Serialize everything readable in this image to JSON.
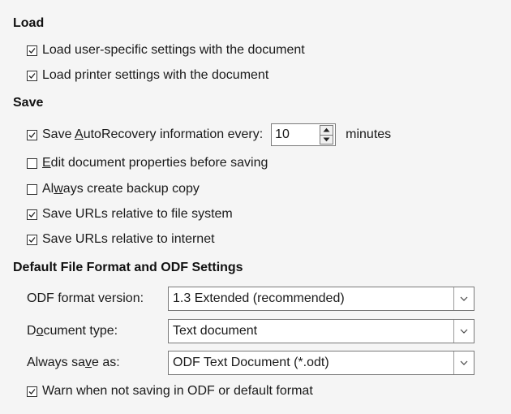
{
  "load": {
    "title": "Load",
    "options": [
      {
        "label": "Load user-specific settings with the document",
        "checked": true
      },
      {
        "label": "Load printer settings with the document",
        "checked": true
      }
    ]
  },
  "save": {
    "title": "Save",
    "autorecovery": {
      "label_pre": "Save ",
      "label_mnemonic": "A",
      "label_post": "utoRecovery information every:",
      "checked": true,
      "value": "10",
      "unit": "minutes"
    },
    "edit_props": {
      "label_mnemonic": "E",
      "label_post": "dit document properties before saving",
      "checked": false
    },
    "backup": {
      "label_pre": "Al",
      "label_mnemonic": "w",
      "label_post": "ays create backup copy",
      "checked": false
    },
    "urls_fs": {
      "label": "Save URLs relative to file system",
      "checked": true
    },
    "urls_inet": {
      "label": "Save URLs relative to internet",
      "checked": true
    }
  },
  "odf": {
    "title": "Default File Format and ODF Settings",
    "format_version": {
      "label": "ODF format version:",
      "value": "1.3 Extended (recommended)"
    },
    "doc_type": {
      "label_pre": "D",
      "label_mnemonic": "o",
      "label_post": "cument type:",
      "value": "Text document"
    },
    "save_as": {
      "label_pre": "Always sa",
      "label_mnemonic": "v",
      "label_post": "e as:",
      "value": "ODF Text Document (*.odt)"
    },
    "warn": {
      "label": "Warn when not saving in ODF or default format",
      "checked": true
    }
  }
}
